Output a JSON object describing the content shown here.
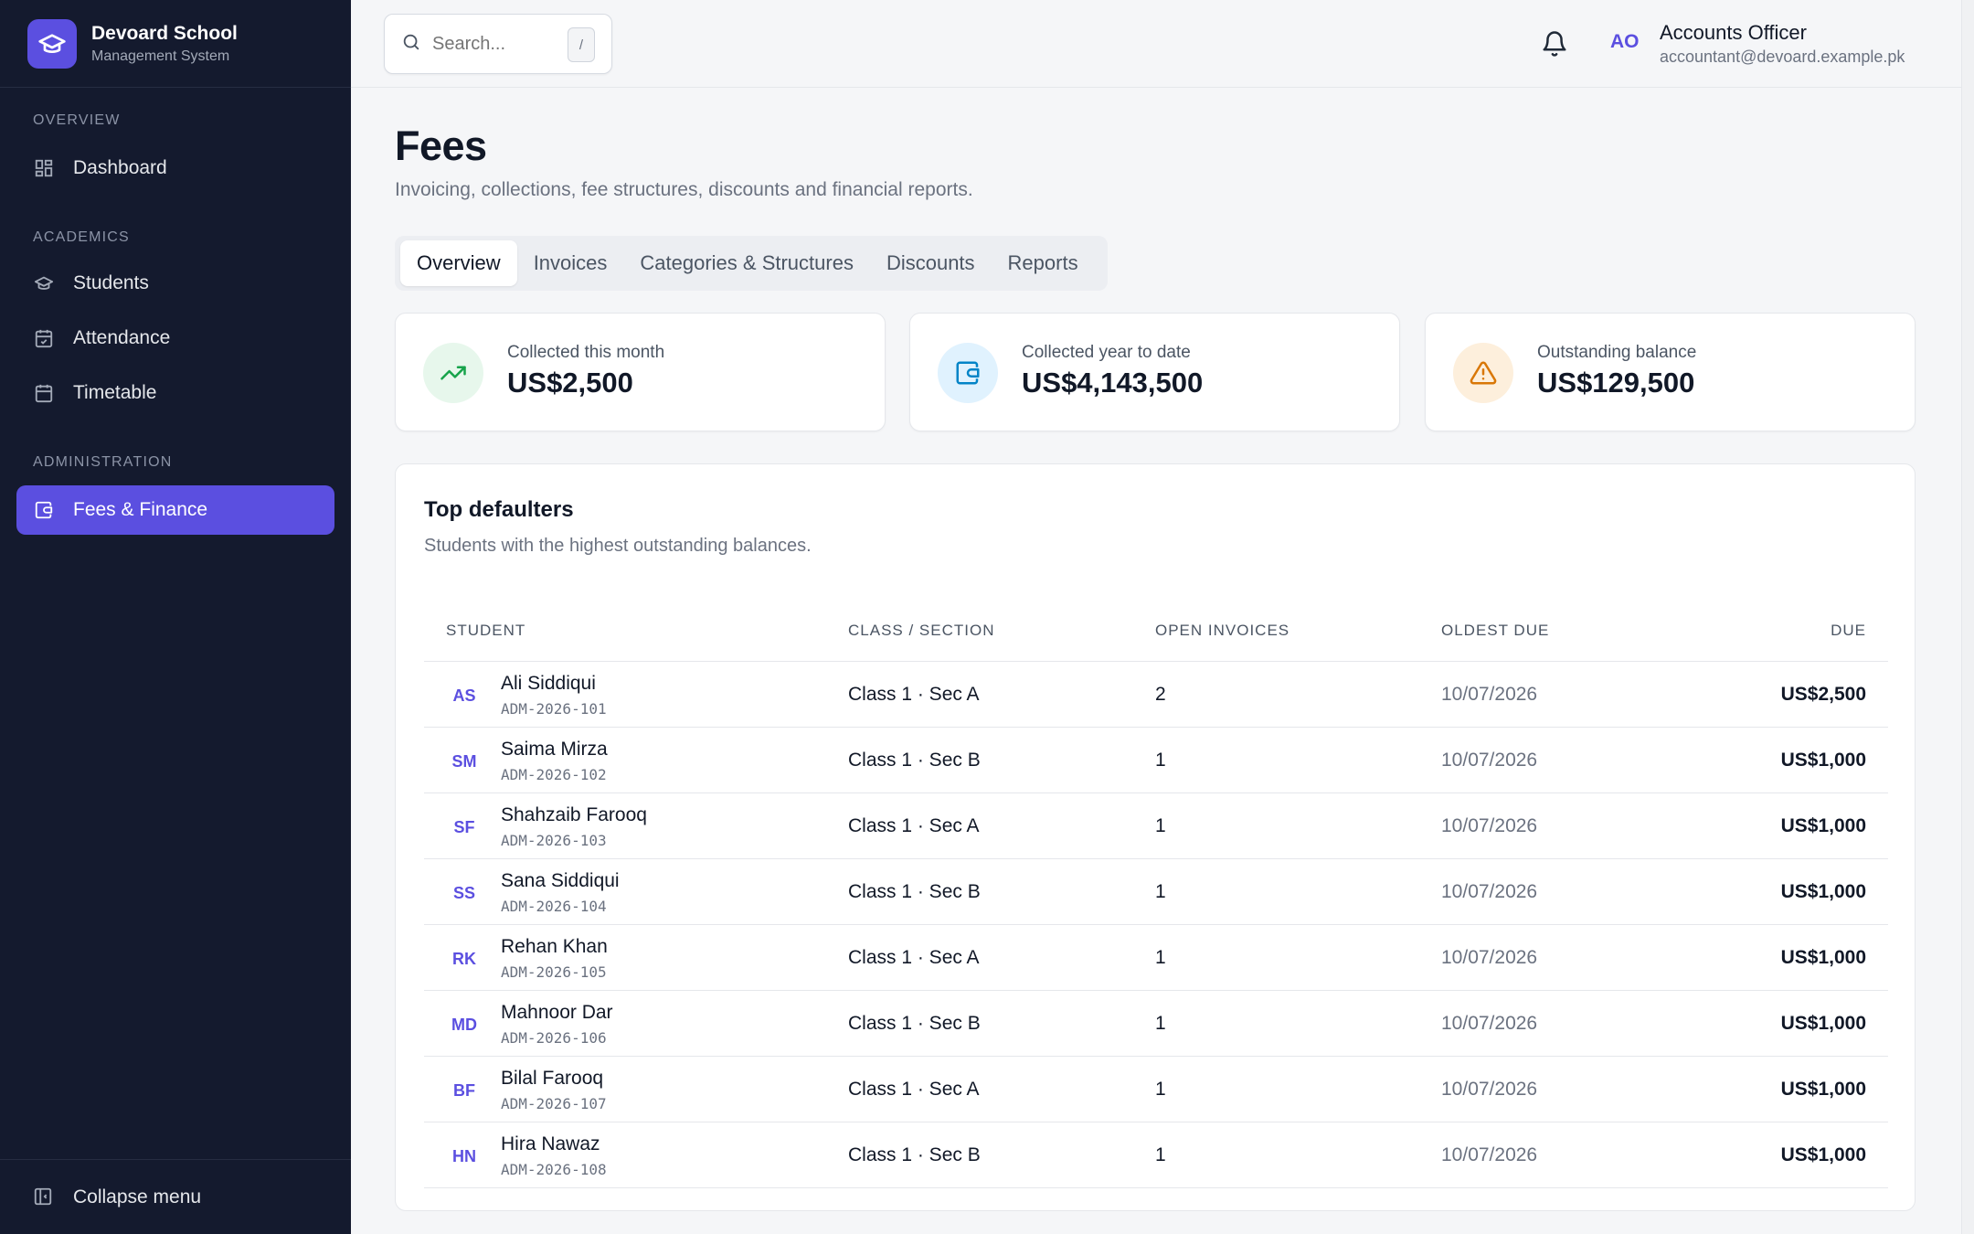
{
  "brand": {
    "title": "Devoard School",
    "subtitle": "Management System"
  },
  "sidebar": {
    "sections": [
      {
        "label": "OVERVIEW"
      },
      {
        "label": "ACADEMICS"
      },
      {
        "label": "ADMINISTRATION"
      }
    ],
    "items": [
      {
        "label": "Dashboard",
        "icon": "grid-icon"
      },
      {
        "label": "Students",
        "icon": "graduation-cap-icon"
      },
      {
        "label": "Attendance",
        "icon": "calendar-check-icon"
      },
      {
        "label": "Timetable",
        "icon": "calendar-icon"
      },
      {
        "label": "Fees & Finance",
        "icon": "wallet-icon",
        "active": true
      }
    ],
    "collapse_label": "Collapse menu"
  },
  "topbar": {
    "search_placeholder": "Search...",
    "search_shortcut": "/",
    "user_initials": "AO",
    "user_name": "Accounts Officer",
    "user_email": "accountant@devoard.example.pk"
  },
  "page": {
    "title": "Fees",
    "subtitle": "Invoicing, collections, fee structures, discounts and financial reports."
  },
  "tabs": [
    {
      "label": "Overview",
      "active": true
    },
    {
      "label": "Invoices"
    },
    {
      "label": "Categories & Structures"
    },
    {
      "label": "Discounts"
    },
    {
      "label": "Reports"
    }
  ],
  "stats": [
    {
      "label": "Collected this month",
      "value": "US$2,500",
      "icon": "trending-up-icon",
      "color": "#16a34a",
      "bg": "#e7f7ec"
    },
    {
      "label": "Collected year to date",
      "value": "US$4,143,500",
      "icon": "wallet-icon",
      "color": "#0284c7",
      "bg": "#e0f2fe"
    },
    {
      "label": "Outstanding balance",
      "value": "US$129,500",
      "icon": "alert-triangle-icon",
      "color": "#d97706",
      "bg": "#fdefdc"
    }
  ],
  "defaulters": {
    "title": "Top defaulters",
    "subtitle": "Students with the highest outstanding balances.",
    "columns": [
      "STUDENT",
      "CLASS / SECTION",
      "OPEN INVOICES",
      "OLDEST DUE",
      "DUE"
    ],
    "rows": [
      {
        "initials": "AS",
        "name": "Ali Siddiqui",
        "id": "ADM-2026-101",
        "class": "Class 1 · Sec A",
        "open": "2",
        "oldest": "10/07/2026",
        "due": "US$2,500"
      },
      {
        "initials": "SM",
        "name": "Saima Mirza",
        "id": "ADM-2026-102",
        "class": "Class 1 · Sec B",
        "open": "1",
        "oldest": "10/07/2026",
        "due": "US$1,000"
      },
      {
        "initials": "SF",
        "name": "Shahzaib Farooq",
        "id": "ADM-2026-103",
        "class": "Class 1 · Sec A",
        "open": "1",
        "oldest": "10/07/2026",
        "due": "US$1,000"
      },
      {
        "initials": "SS",
        "name": "Sana Siddiqui",
        "id": "ADM-2026-104",
        "class": "Class 1 · Sec B",
        "open": "1",
        "oldest": "10/07/2026",
        "due": "US$1,000"
      },
      {
        "initials": "RK",
        "name": "Rehan Khan",
        "id": "ADM-2026-105",
        "class": "Class 1 · Sec A",
        "open": "1",
        "oldest": "10/07/2026",
        "due": "US$1,000"
      },
      {
        "initials": "MD",
        "name": "Mahnoor Dar",
        "id": "ADM-2026-106",
        "class": "Class 1 · Sec B",
        "open": "1",
        "oldest": "10/07/2026",
        "due": "US$1,000"
      },
      {
        "initials": "BF",
        "name": "Bilal Farooq",
        "id": "ADM-2026-107",
        "class": "Class 1 · Sec A",
        "open": "1",
        "oldest": "10/07/2026",
        "due": "US$1,000"
      },
      {
        "initials": "HN",
        "name": "Hira Nawaz",
        "id": "ADM-2026-108",
        "class": "Class 1 · Sec B",
        "open": "1",
        "oldest": "10/07/2026",
        "due": "US$1,000"
      }
    ]
  }
}
